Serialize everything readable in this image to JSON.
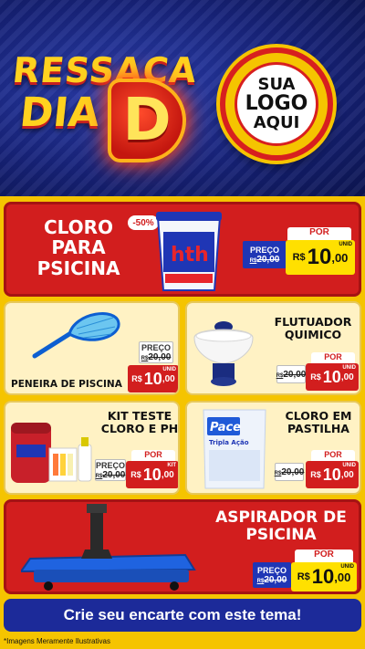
{
  "header": {
    "title_line1": "RESSACA",
    "title_line2": "DIA",
    "title_letter": "D",
    "logo_line1": "SUA",
    "logo_line2": "LOGO",
    "logo_line3": "AQUI"
  },
  "products": [
    {
      "title_lines": [
        "CLORO",
        "PARA",
        "PSICINA"
      ],
      "discount_badge": "-50%",
      "product_brand": "hth",
      "product_label": "Tradicional",
      "price_label": "PREÇO",
      "old_price": "20,00",
      "old_prefix": "R$",
      "por_label": "POR",
      "currency": "R$",
      "new_price_int": "10",
      "new_price_dec": ",00",
      "unit": "UNID"
    },
    {
      "title": "PENEIRA DE PISCINA",
      "price_label": "PREÇO",
      "old_price": "20,00",
      "old_prefix": "R$",
      "currency": "R$",
      "new_price_int": "10",
      "new_price_dec": ",00",
      "unit": "UNID"
    },
    {
      "title_lines": [
        "FLUTUADOR",
        "QUIMICO"
      ],
      "price_label": "POR",
      "old_price": "20,00",
      "old_prefix": "R$",
      "currency": "R$",
      "new_price_int": "10",
      "new_price_dec": ",00",
      "unit": "UNID"
    },
    {
      "title_lines": [
        "KIT TESTE",
        "CLORO E PH"
      ],
      "price_label": "PREÇO",
      "por_label": "POR",
      "old_price": "20,00",
      "old_prefix": "R$",
      "currency": "R$",
      "new_price_int": "10",
      "new_price_dec": ",00",
      "unit": "KIT"
    },
    {
      "title_lines": [
        "CLORO EM",
        "PASTILHA"
      ],
      "product_brand": "Pace",
      "product_label": "Tripla Ação",
      "por_label": "POR",
      "old_price": "20,00",
      "old_prefix": "R$",
      "currency": "R$",
      "new_price_int": "10",
      "new_price_dec": ",00",
      "unit": "UNID"
    },
    {
      "title_lines": [
        "ASPIRADOR DE",
        "PSICINA"
      ],
      "price_label": "PREÇO",
      "por_label": "POR",
      "old_price": "20,00",
      "old_prefix": "R$",
      "currency": "R$",
      "new_price_int": "10",
      "new_price_dec": ",00",
      "unit": "UNID"
    }
  ],
  "footer": {
    "cta": "Crie seu encarte com este tema!",
    "disclaimer": "*Imagens Meramente Ilustrativas"
  },
  "colors": {
    "brand_blue": "#1c2a99",
    "brand_red": "#d21e1e",
    "brand_yellow": "#f5c400",
    "price_yellow": "#ffe000"
  }
}
